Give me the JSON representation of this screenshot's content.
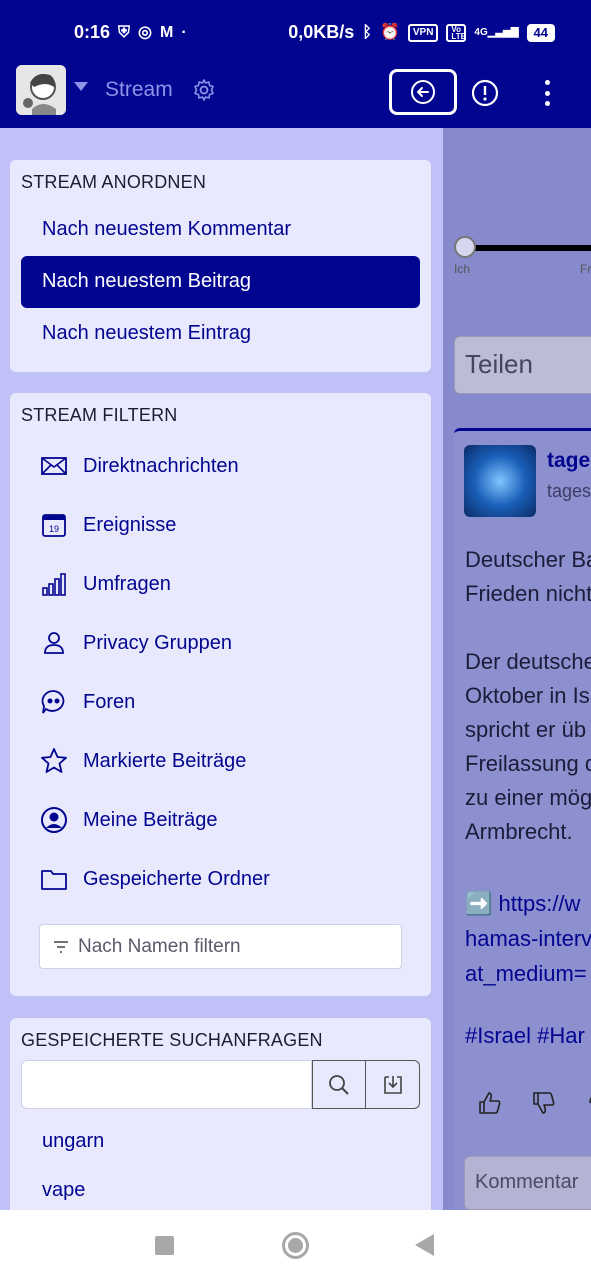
{
  "status_bar": {
    "time": "0:16",
    "net_speed": "0,0KB/s",
    "vpn_label": "VPN",
    "volte_label": "Vo LTE",
    "network_label": "4G",
    "battery": "44"
  },
  "app_bar": {
    "title": "Stream"
  },
  "background_post": {
    "slider_left": "Ich",
    "slider_right": "Fr",
    "share_placeholder": "Teilen",
    "author": "tage",
    "handle": "tages",
    "text": "Deutscher Ba\nFrieden nicht\n\nDer deutsche\nOktober in Is\nspricht er üb\nFreilassung d\nzu einer mög\nArmbrecht.",
    "link": "➡️ https://w\nhamas-interv\nat_medium=",
    "tags": "#Israel #Har",
    "comment_placeholder": "Kommentar"
  },
  "sort_panel": {
    "heading": "STREAM ANORDNEN",
    "items": [
      {
        "label": "Nach neuestem Kommentar",
        "active": false
      },
      {
        "label": "Nach neuestem Beitrag",
        "active": true
      },
      {
        "label": "Nach neuestem Eintrag",
        "active": false
      }
    ]
  },
  "filter_panel": {
    "heading": "STREAM FILTERN",
    "items": [
      {
        "label": "Direktnachrichten",
        "icon": "envelope-icon"
      },
      {
        "label": "Ereignisse",
        "icon": "calendar-icon",
        "icon_text": "19"
      },
      {
        "label": "Umfragen",
        "icon": "bar-chart-icon"
      },
      {
        "label": "Privacy Gruppen",
        "icon": "person-icon"
      },
      {
        "label": "Foren",
        "icon": "quote-bubble-icon"
      },
      {
        "label": "Markierte Beiträge",
        "icon": "star-icon"
      },
      {
        "label": "Meine Beiträge",
        "icon": "user-circle-icon"
      },
      {
        "label": "Gespeicherte Ordner",
        "icon": "folder-icon"
      }
    ],
    "name_filter_placeholder": "Nach Namen filtern"
  },
  "saved_searches": {
    "heading": "GESPEICHERTE SUCHANFRAGEN",
    "search_value": "",
    "items": [
      "ungarn",
      "vape"
    ]
  },
  "colors": {
    "primary": "#020590",
    "drawer_bg": "#bfc1f7",
    "panel_bg": "#e8e9fd"
  }
}
